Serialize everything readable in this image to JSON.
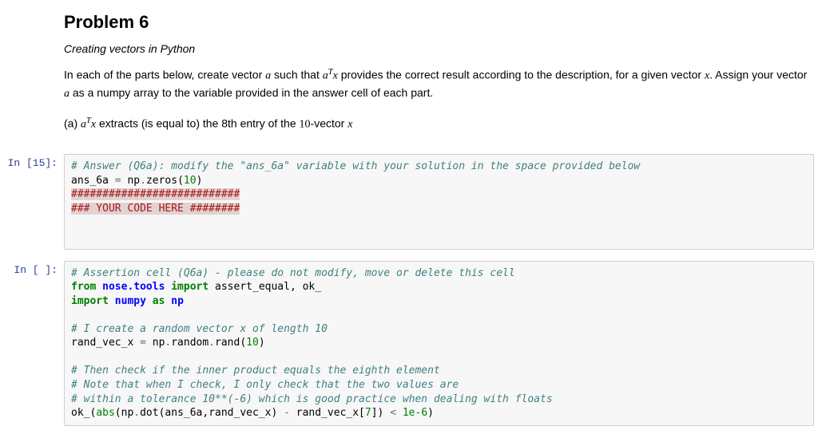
{
  "problem": {
    "title": "Problem 6",
    "subtitle": "Creating vectors in Python",
    "desc_1a": "In each of the parts below, create vector ",
    "desc_var_a": "a",
    "desc_1b": " such that ",
    "desc_aT": "a",
    "desc_aT_sup": "T",
    "desc_x": "x",
    "desc_1c": " provides the correct result according to the description, for a given vector ",
    "desc_x2": "x",
    "desc_1d": ". Assign your vector ",
    "desc_2a": " as a numpy array to the variable provided in the answer cell of each part.",
    "part_a_lead": "(a) ",
    "part_a_mid": " extracts (is equal to) the 8th entry of the ",
    "part_a_ten": "10",
    "part_a_tail": "-vector "
  },
  "cells": {
    "c1": {
      "prompt": "In [15]:",
      "l1a": "# Answer (Q6a): modify the \"ans_6a\" variable with your solution in the space provided below",
      "l2a": "ans_6a ",
      "l2b": "=",
      "l2c": " np",
      "l2d": ".",
      "l2e": "zeros(",
      "l2f": "10",
      "l2g": ")",
      "l3a": "###########################",
      "l4a": "### YOUR CODE HERE ########"
    },
    "c2": {
      "prompt": "In [ ]:",
      "l1a": "# Assertion cell (Q6a) - please do not modify, move or delete this cell",
      "l2a": "from",
      "l2b": " nose.tools ",
      "l2c": "import",
      "l2d": " assert_equal, ok_",
      "l3a": "import",
      "l3b": " numpy ",
      "l3c": "as",
      "l3d": " np",
      "l5a": "# I create a random vector x of length 10",
      "l6a": "rand_vec_x ",
      "l6b": "=",
      "l6c": " np",
      "l6d": ".",
      "l6e": "random",
      "l6f": ".",
      "l6g": "rand(",
      "l6h": "10",
      "l6i": ")",
      "l8a": "# Then check if the inner product equals the eighth element",
      "l9a": "# Note that when I check, I only check that the two values are",
      "l10a": "# within a tolerance 10**(-6) which is good practice when dealing with floats",
      "l11a": "ok_(",
      "l11b": "abs",
      "l11c": "(np",
      "l11d": ".",
      "l11e": "dot(ans_6a,rand_vec_x) ",
      "l11f": "-",
      "l11g": " rand_vec_x[",
      "l11h": "7",
      "l11i": "]) ",
      "l11j": "<",
      "l11k": " ",
      "l11l": "1e-6",
      "l11m": ")"
    }
  }
}
